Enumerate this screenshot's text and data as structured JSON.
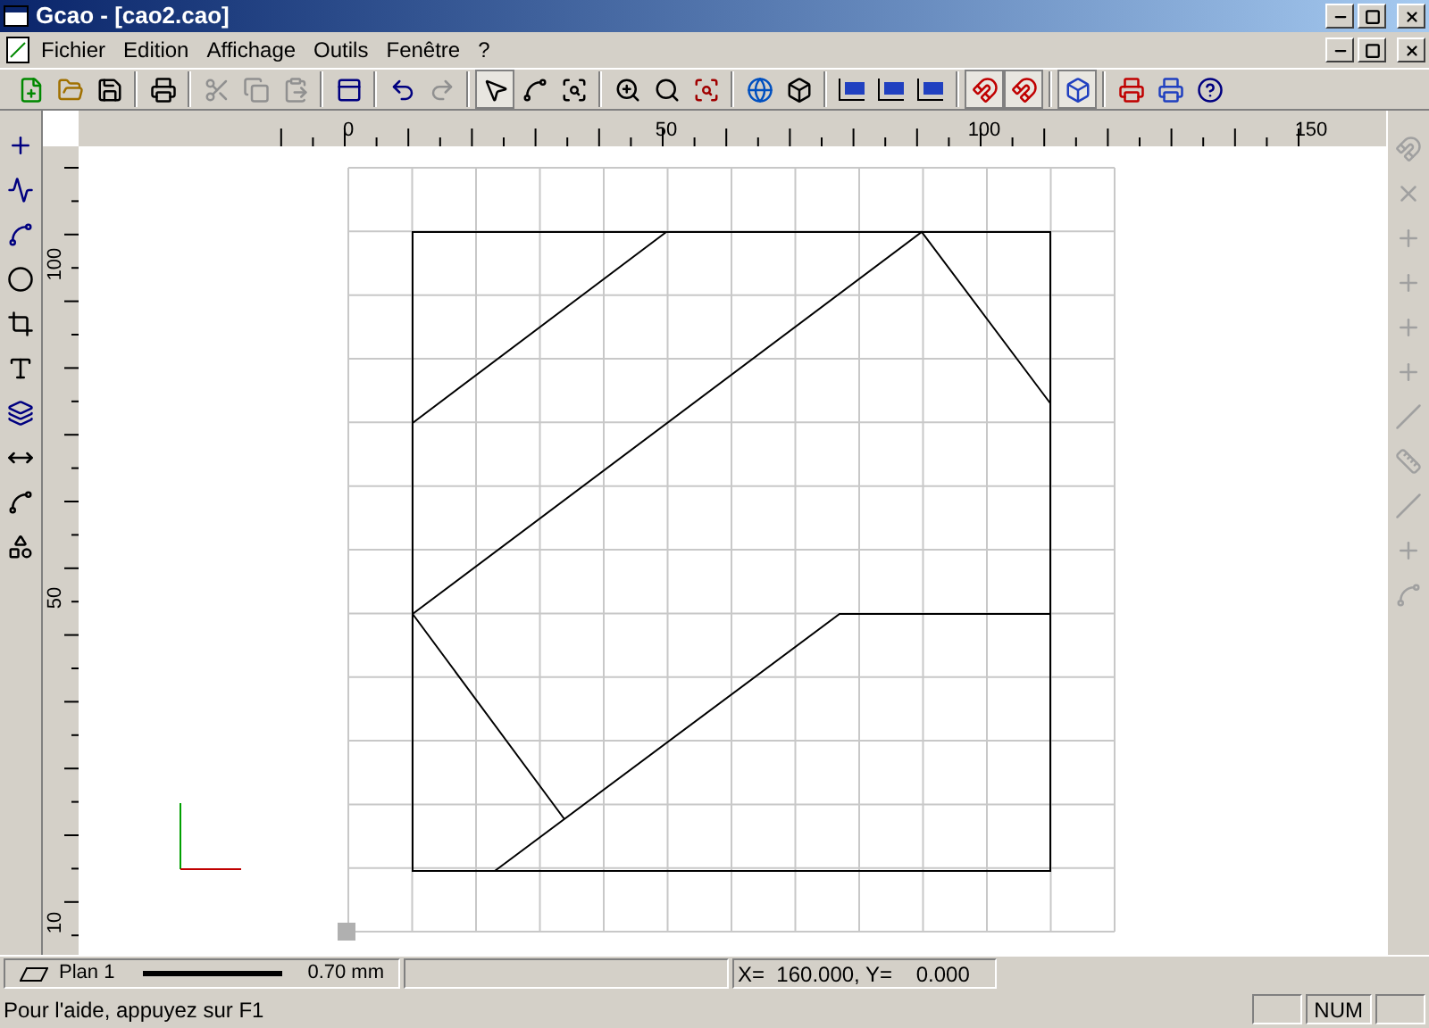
{
  "window": {
    "title": "Gcao - [cao2.cao]"
  },
  "menu": [
    {
      "label": "Fichier"
    },
    {
      "label": "Edition"
    },
    {
      "label": "Affichage"
    },
    {
      "label": "Outils"
    },
    {
      "label": "Fenêtre"
    },
    {
      "label": "?"
    }
  ],
  "ruler_top": {
    "labels": [
      "0",
      "50",
      "100",
      "150"
    ]
  },
  "ruler_left": {
    "labels": [
      "100",
      "50",
      "10"
    ]
  },
  "status_bar": {
    "plane": "Plan 1",
    "line_width": "0.70 mm",
    "coords": "X=  160.000, Y=    0.000"
  },
  "help_line": {
    "text": "Pour l'aide, appuyez sur F1",
    "indicators": [
      "NUM"
    ]
  }
}
